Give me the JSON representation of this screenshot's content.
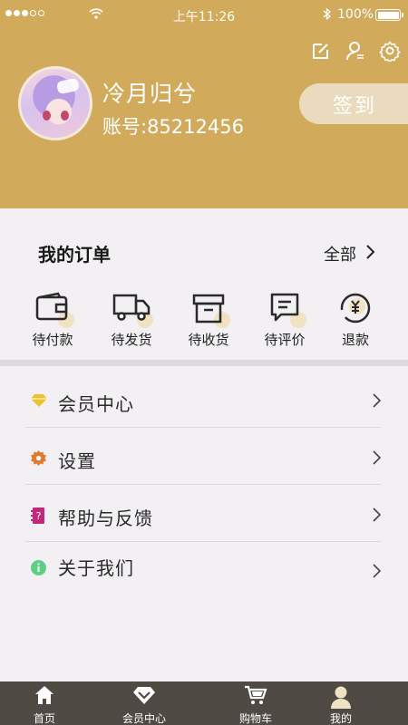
{
  "status_bar": {
    "time": "上午11:26",
    "battery": "100%"
  },
  "profile": {
    "username": "冷月归兮",
    "account": "账号:85212456",
    "checkin_label": "签到"
  },
  "orders": {
    "title": "我的订单",
    "all_label": "全部",
    "items": [
      {
        "label": "待付款",
        "icon": "wallet-icon"
      },
      {
        "label": "待发货",
        "icon": "truck-icon"
      },
      {
        "label": "待收货",
        "icon": "box-icon"
      },
      {
        "label": "待评价",
        "icon": "comment-icon"
      },
      {
        "label": "退款",
        "icon": "refund-icon"
      }
    ]
  },
  "menu": {
    "items": [
      {
        "label": "会员中心",
        "icon": "diamond-icon",
        "color": "#f0c12f"
      },
      {
        "label": "设置",
        "icon": "gear-icon",
        "color": "#e07a2e"
      },
      {
        "label": "帮助与反馈",
        "icon": "help-book-icon",
        "color": "#c2287a"
      },
      {
        "label": "关于我们",
        "icon": "info-icon",
        "color": "#5ccf83"
      }
    ]
  },
  "tabbar": {
    "items": [
      {
        "label": "首页",
        "icon": "home-icon"
      },
      {
        "label": "会员中心",
        "icon": "member-icon"
      },
      {
        "label": "购物车",
        "icon": "cart-icon"
      },
      {
        "label": "我的",
        "icon": "user-icon",
        "active": true
      }
    ]
  },
  "colors": {
    "brand": "#d1aa5c",
    "tabbar": "#4f4a44",
    "accent_light": "#f1e2c3"
  }
}
